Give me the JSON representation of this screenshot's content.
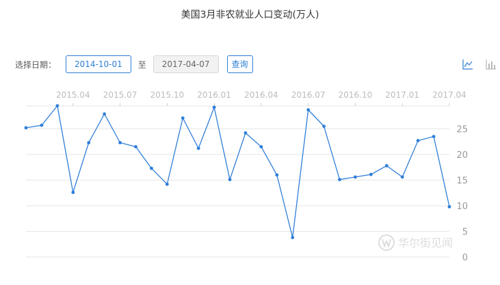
{
  "header": {
    "title": "美国3月非农就业人口变动(万人)"
  },
  "controls": {
    "select_label": "选择日期：",
    "start_date": "2014-10-01",
    "to_label": "至",
    "end_date": "2017-04-07",
    "query_label": "查询"
  },
  "toolbar": {
    "icons": [
      "line-chart-icon",
      "bar-chart-icon"
    ]
  },
  "watermark": {
    "text": "华尔街见闻"
  },
  "colors": {
    "accent": "#2d7fd3",
    "line": "#2f7ed8",
    "grid": "#e6e6e6",
    "axis_text": "#999999",
    "top_tick_text": "#bbbbbb"
  },
  "chart_data": {
    "type": "line",
    "title": "美国3月非农就业人口变动(万人)",
    "xlabel": "",
    "ylabel": "",
    "x_tick_labels": [
      "2015.04",
      "2015.07",
      "2015.10",
      "2016.01",
      "2016.04",
      "2016.07",
      "2016.10",
      "2017.01",
      "2017.04"
    ],
    "x_axis_position": "top",
    "y_axis_position": "right",
    "ylim": [
      0,
      30
    ],
    "y_ticks": [
      0,
      5,
      10,
      15,
      20,
      25
    ],
    "grid": true,
    "x": [
      "2015.01",
      "2015.02",
      "2015.03",
      "2015.04",
      "2015.05",
      "2015.06",
      "2015.07",
      "2015.08",
      "2015.09",
      "2015.10",
      "2015.11",
      "2015.12",
      "2016.01",
      "2016.02",
      "2016.03",
      "2016.04",
      "2016.05",
      "2016.06",
      "2016.07",
      "2016.08",
      "2016.09",
      "2016.10",
      "2016.11",
      "2016.12",
      "2017.01",
      "2017.02",
      "2017.03",
      "2017.04"
    ],
    "values": [
      25.2,
      25.7,
      29.5,
      12.6,
      22.3,
      27.9,
      22.3,
      21.5,
      17.3,
      14.2,
      27.1,
      21.2,
      29.2,
      15.1,
      24.2,
      21.5,
      16.0,
      3.8,
      28.7,
      25.5,
      15.1,
      15.6,
      16.1,
      17.8,
      15.6,
      22.7,
      23.5,
      9.8
    ]
  }
}
